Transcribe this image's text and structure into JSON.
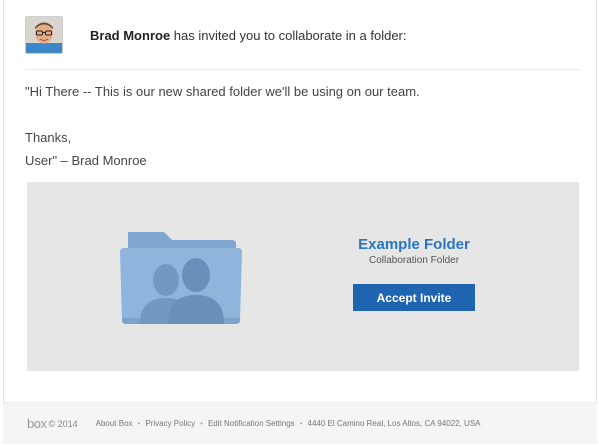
{
  "header": {
    "sender_name": "Brad Monroe",
    "invite_text": "has invited you to collaborate in a folder:"
  },
  "message": {
    "line1": "\"Hi There -- This is our new shared folder we'll be using on our team.",
    "line2": "Thanks,",
    "line3": "User\" – Brad Monroe"
  },
  "folder": {
    "name": "Example Folder",
    "subtitle": "Collaboration Folder",
    "accept_label": "Accept Invite"
  },
  "footer": {
    "logo": "box",
    "copyright": "© 2014",
    "links": [
      "About Box",
      "Privacy Policy",
      "Edit Notification Settings"
    ],
    "address": "4440 El Camino Real, Los Altos, CA 94022, USA",
    "separator": "•"
  },
  "colors": {
    "accent": "#2a75c0",
    "button": "#1e64b0",
    "card_bg": "#e6e6e6",
    "folder_blue": "#8fb5dc"
  }
}
